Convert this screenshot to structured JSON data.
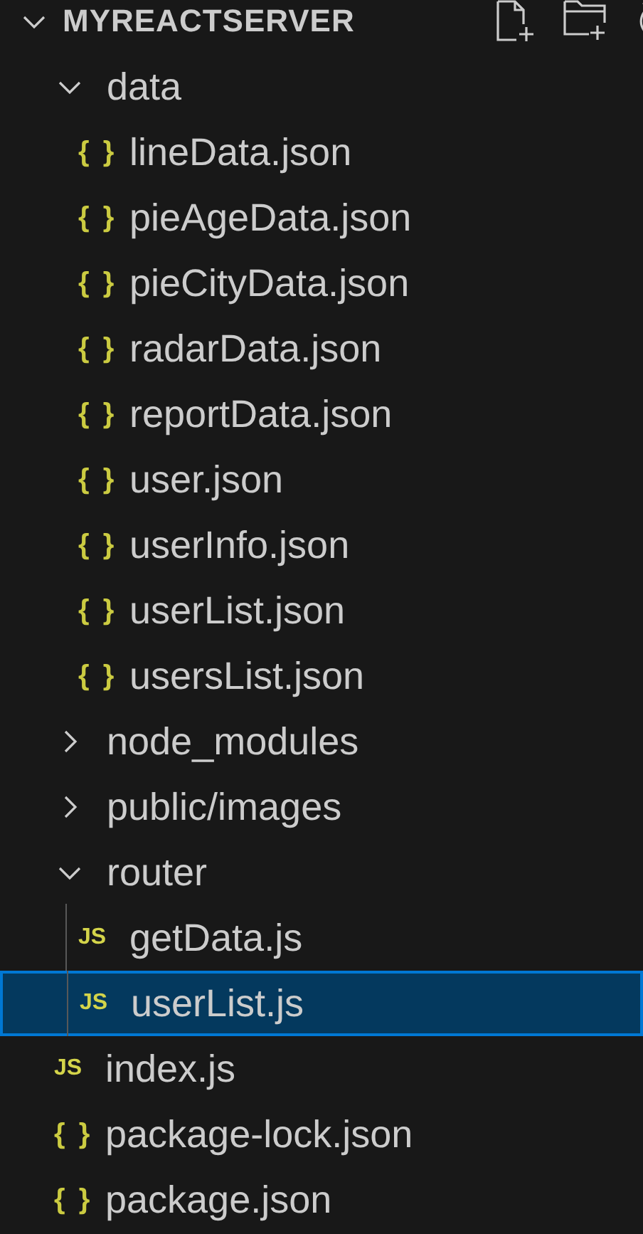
{
  "explorer": {
    "title": "MYREACTSERVER",
    "expanded": true,
    "items": [
      {
        "kind": "folder",
        "label": "data",
        "expanded": true,
        "selected": false,
        "children": [
          {
            "kind": "json",
            "icon": "{ }",
            "label": "lineData.json",
            "selected": false
          },
          {
            "kind": "json",
            "icon": "{ }",
            "label": "pieAgeData.json",
            "selected": false
          },
          {
            "kind": "json",
            "icon": "{ }",
            "label": "pieCityData.json",
            "selected": false
          },
          {
            "kind": "json",
            "icon": "{ }",
            "label": "radarData.json",
            "selected": false
          },
          {
            "kind": "json",
            "icon": "{ }",
            "label": "reportData.json",
            "selected": false
          },
          {
            "kind": "json",
            "icon": "{ }",
            "label": "user.json",
            "selected": false
          },
          {
            "kind": "json",
            "icon": "{ }",
            "label": "userInfo.json",
            "selected": false
          },
          {
            "kind": "json",
            "icon": "{ }",
            "label": "userList.json",
            "selected": false
          },
          {
            "kind": "json",
            "icon": "{ }",
            "label": "usersList.json",
            "selected": false
          }
        ]
      },
      {
        "kind": "folder",
        "label": "node_modules",
        "expanded": false,
        "selected": false
      },
      {
        "kind": "folder",
        "label": "public/images",
        "expanded": false,
        "selected": false
      },
      {
        "kind": "folder",
        "label": "router",
        "expanded": true,
        "selected": false,
        "children": [
          {
            "kind": "js",
            "icon": "JS",
            "label": "getData.js",
            "selected": false
          },
          {
            "kind": "js",
            "icon": "JS",
            "label": "userList.js",
            "selected": true
          }
        ]
      },
      {
        "kind": "js",
        "icon": "JS",
        "label": "index.js",
        "selected": false
      },
      {
        "kind": "json",
        "icon": "{ }",
        "label": "package-lock.json",
        "selected": false
      },
      {
        "kind": "json",
        "icon": "{ }",
        "label": "package.json",
        "selected": false
      }
    ]
  }
}
